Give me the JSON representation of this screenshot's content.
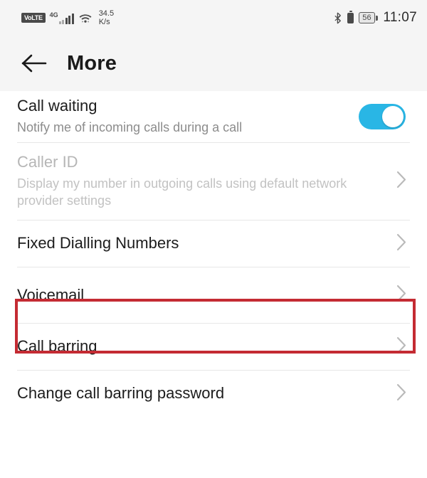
{
  "status_bar": {
    "volte_label": "VoLTE",
    "network_type": "4G",
    "signal_icon": "signal-bars-icon",
    "wifi_icon": "wifi-icon",
    "network_speed_value": "34.5",
    "network_speed_unit": "K/s",
    "bluetooth_icon": "bluetooth-icon",
    "battery_icon": "battery-icon",
    "battery_percent": "56",
    "clock": "11:07"
  },
  "app_bar": {
    "back_icon": "back-arrow-icon",
    "title": "More"
  },
  "colors": {
    "toggle_on": "#29b6e5",
    "highlight": "#c42b33",
    "header_bg": "#f5f5f5",
    "divider": "#e7e7e7"
  },
  "list": {
    "items": [
      {
        "id": "call-waiting",
        "title": "Call waiting",
        "subtitle": "Notify me of incoming calls during a call",
        "control": "toggle",
        "toggle_state": "on",
        "disabled": false,
        "highlighted": false
      },
      {
        "id": "caller-id",
        "title": "Caller ID",
        "subtitle": "Display my number in outgoing calls using default network provider settings",
        "control": "chevron",
        "disabled": true,
        "highlighted": false
      },
      {
        "id": "fixed-dialling-numbers",
        "title": "Fixed Dialling Numbers",
        "subtitle": "",
        "control": "chevron",
        "disabled": false,
        "highlighted": false
      },
      {
        "id": "voicemail",
        "title": "Voicemail",
        "subtitle": "",
        "control": "chevron",
        "disabled": false,
        "highlighted": true
      },
      {
        "id": "call-barring",
        "title": "Call barring",
        "subtitle": "",
        "control": "chevron",
        "disabled": false,
        "highlighted": false
      },
      {
        "id": "change-call-barring-password",
        "title": "Change call barring password",
        "subtitle": "",
        "control": "chevron",
        "disabled": false,
        "highlighted": false
      }
    ]
  }
}
